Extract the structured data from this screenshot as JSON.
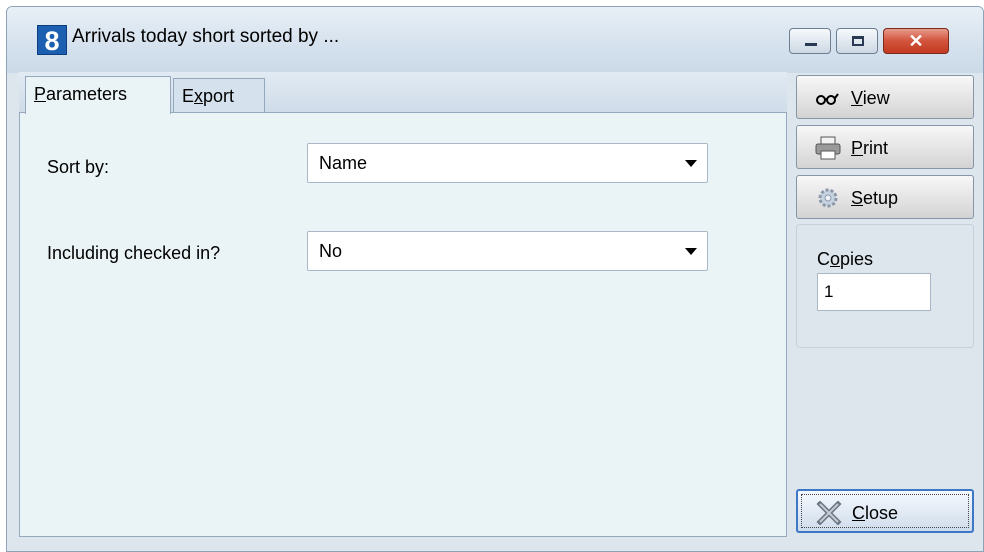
{
  "window": {
    "title": "Arrivals today short sorted by ...",
    "app_icon": "8",
    "controls": {
      "minimize": "minimize-icon",
      "maximize": "maximize-icon",
      "close": "close-icon",
      "close_glyph": "✕"
    }
  },
  "tabs": [
    {
      "prefix": "",
      "accel": "P",
      "rest": "arameters"
    },
    {
      "prefix": "E",
      "accel": "x",
      "rest": "port"
    }
  ],
  "params": {
    "sort_by": {
      "label": "Sort by:",
      "value": "Name"
    },
    "including_checked_in": {
      "label": "Including checked in?",
      "value": "No"
    }
  },
  "buttons": {
    "view": {
      "accel": "V",
      "rest": "iew",
      "icon": "glasses-icon"
    },
    "print": {
      "accel": "P",
      "rest": "rint",
      "icon": "printer-icon"
    },
    "setup": {
      "accel": "S",
      "rest": "etup",
      "icon": "gear-icon"
    },
    "close": {
      "accel": "C",
      "rest": "lose",
      "icon": "close-x-icon"
    }
  },
  "copies": {
    "label_pre": "C",
    "label_accel": "o",
    "label_rest": "pies",
    "value": "1"
  }
}
